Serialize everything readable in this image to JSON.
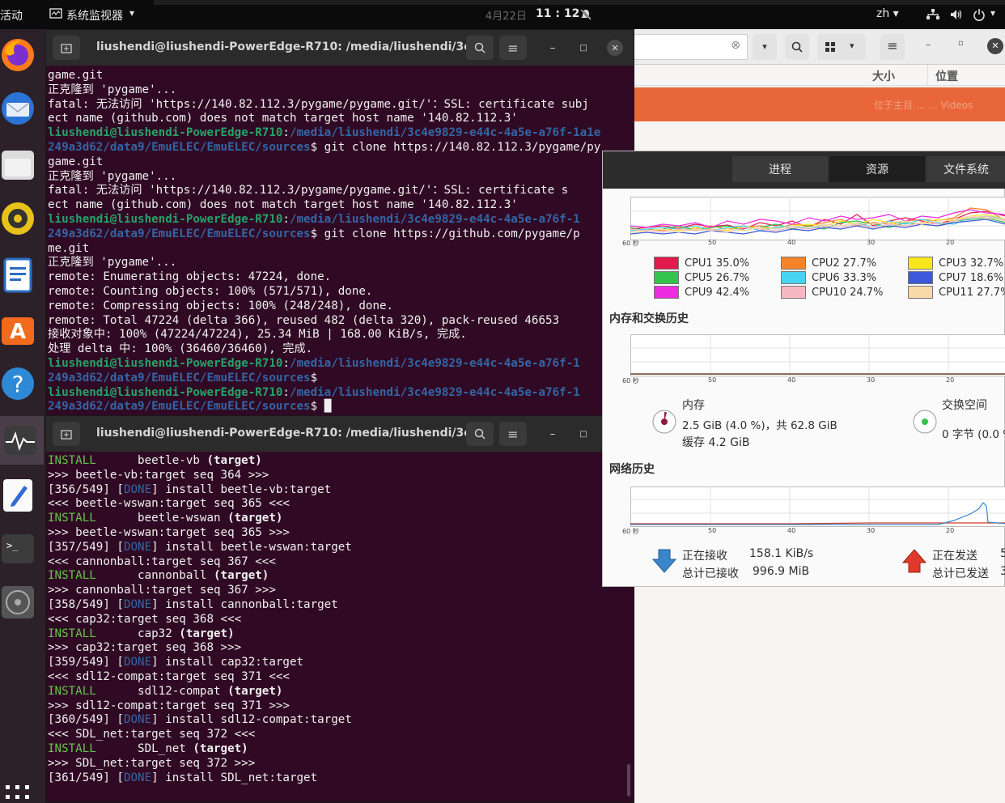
{
  "topbar": {
    "activities": "活动",
    "app_name": "系统监视器",
    "app_caret": "▾",
    "date_faint": "4月22日",
    "clock": "11 : 12",
    "lang": "zh ▾"
  },
  "dock": [
    "firefox-icon",
    "thunderbird-icon",
    "files-icon",
    "rhythmbox-icon",
    "writer-icon",
    "software-icon",
    "help-icon",
    "system-monitor-icon",
    "text-editor-icon",
    "terminal-icon",
    "disc-icon",
    "apps-grid-icon"
  ],
  "term1": {
    "title": "liushendi@liushendi-PowerEdge-R710: /media/liushendi/3c4...",
    "lines": [
      [
        [
          "",
          "game.git"
        ]
      ],
      [
        [
          "",
          "正克隆到 'pygame'..."
        ]
      ],
      [
        [
          "",
          "fatal: 无法访问 'https://140.82.112.3/pygame/pygame.git/'：SSL: certificate subj"
        ]
      ],
      [
        [
          "",
          "ect name (github.com) does not match target host name '140.82.112.3'"
        ]
      ],
      [
        [
          "pu",
          "liushendi@liushendi-PowerEdge-R710"
        ],
        [
          "",
          ":"
        ],
        [
          "pp",
          "/media/liushendi/3c4e9829-e44c-4a5e-a76f-1a1e"
        ]
      ],
      [
        [
          "pp",
          "249a3d62/data9/EmuELEC/EmuELEC/sources"
        ],
        [
          "",
          "$ git clone https://140.82.112.3/pygame/py"
        ]
      ],
      [
        [
          "",
          "game.git"
        ]
      ],
      [
        [
          "",
          "正克隆到 'pygame'..."
        ]
      ],
      [
        [
          "",
          "fatal: 无法访问 'https://140.82.112.3/pygame/pygame.git/'：SSL: certificate s"
        ]
      ],
      [
        [
          "",
          "ect name (github.com) does not match target host name '140.82.112.3'"
        ]
      ],
      [
        [
          "pu",
          "liushendi@liushendi-PowerEdge-R710"
        ],
        [
          "",
          ":"
        ],
        [
          "pp",
          "/media/liushendi/3c4e9829-e44c-4a5e-a76f-1"
        ]
      ],
      [
        [
          "pp",
          "249a3d62/data9/EmuELEC/EmuELEC/sources"
        ],
        [
          "",
          "$ git clone https://github.com/pygame/p"
        ]
      ],
      [
        [
          "",
          "me.git"
        ]
      ],
      [
        [
          "",
          "正克隆到 'pygame'..."
        ]
      ],
      [
        [
          "",
          "remote: Enumerating objects: 47224, done."
        ]
      ],
      [
        [
          "",
          "remote: Counting objects: 100% (571/571), done."
        ]
      ],
      [
        [
          "",
          "remote: Compressing objects: 100% (248/248), done."
        ]
      ],
      [
        [
          "",
          "remote: Total 47224 (delta 366), reused 482 (delta 320), pack-reused 46653"
        ]
      ],
      [
        [
          "",
          "接收对象中: 100% (47224/47224), 25.34 MiB | 168.00 KiB/s, 完成."
        ]
      ],
      [
        [
          "",
          "处理 delta 中: 100% (36460/36460), 完成."
        ]
      ],
      [
        [
          "pu",
          "liushendi@liushendi-PowerEdge-R710"
        ],
        [
          "",
          ":"
        ],
        [
          "pp",
          "/media/liushendi/3c4e9829-e44c-4a5e-a76f-1"
        ]
      ],
      [
        [
          "pp",
          "249a3d62/data9/EmuELEC/EmuELEC/sources"
        ],
        [
          "",
          "$"
        ]
      ],
      [
        [
          "pu",
          "liushendi@liushendi-PowerEdge-R710"
        ],
        [
          "",
          ":"
        ],
        [
          "pp",
          "/media/liushendi/3c4e9829-e44c-4a5e-a76f-1"
        ]
      ],
      [
        [
          "pp",
          "249a3d62/data9/EmuELEC/EmuELEC/sources"
        ],
        [
          "",
          "$ "
        ],
        [
          "cur",
          "█"
        ]
      ]
    ]
  },
  "term2": {
    "title": "liushendi@liushendi-PowerEdge-R710: /media/liushendi/3c4...",
    "lines": [
      [
        [
          "inst",
          "INSTALL"
        ],
        [
          "",
          "      beetle-vb "
        ],
        [
          "b",
          "(target)"
        ]
      ],
      [
        [
          "",
          ">>> beetle-vb:target seq 364 >>>"
        ]
      ],
      [
        [
          "",
          "[356/549] ["
        ],
        [
          "done",
          "DONE"
        ],
        [
          "",
          "] install beetle-vb:target"
        ]
      ],
      [
        [
          "",
          "<<< beetle-wswan:target seq 365 <<<"
        ]
      ],
      [
        [
          "inst",
          "INSTALL"
        ],
        [
          "",
          "      beetle-wswan "
        ],
        [
          "b",
          "(target)"
        ]
      ],
      [
        [
          "",
          ">>> beetle-wswan:target seq 365 >>>"
        ]
      ],
      [
        [
          "",
          "[357/549] ["
        ],
        [
          "done",
          "DONE"
        ],
        [
          "",
          "] install beetle-wswan:target"
        ]
      ],
      [
        [
          "",
          "<<< cannonball:target seq 367 <<<"
        ]
      ],
      [
        [
          "inst",
          "INSTALL"
        ],
        [
          "",
          "      cannonball "
        ],
        [
          "b",
          "(target)"
        ]
      ],
      [
        [
          "",
          ">>> cannonball:target seq 367 >>>"
        ]
      ],
      [
        [
          "",
          "[358/549] ["
        ],
        [
          "done",
          "DONE"
        ],
        [
          "",
          "] install cannonball:target"
        ]
      ],
      [
        [
          "",
          "<<< cap32:target seq 368 <<<"
        ]
      ],
      [
        [
          "inst",
          "INSTALL"
        ],
        [
          "",
          "      cap32 "
        ],
        [
          "b",
          "(target)"
        ]
      ],
      [
        [
          "",
          ">>> cap32:target seq 368 >>>"
        ]
      ],
      [
        [
          "",
          "[359/549] ["
        ],
        [
          "done",
          "DONE"
        ],
        [
          "",
          "] install cap32:target"
        ]
      ],
      [
        [
          "",
          "<<< sdl12-compat:target seq 371 <<<"
        ]
      ],
      [
        [
          "inst",
          "INSTALL"
        ],
        [
          "",
          "      sdl12-compat "
        ],
        [
          "b",
          "(target)"
        ]
      ],
      [
        [
          "",
          ">>> sdl12-compat:target seq 371 >>>"
        ]
      ],
      [
        [
          "",
          "[360/549] ["
        ],
        [
          "done",
          "DONE"
        ],
        [
          "",
          "] install sdl12-compat:target"
        ]
      ],
      [
        [
          "",
          "<<< SDL_net:target seq 372 <<<"
        ]
      ],
      [
        [
          "inst",
          "INSTALL"
        ],
        [
          "",
          "      SDL_net "
        ],
        [
          "b",
          "(target)"
        ]
      ],
      [
        [
          "",
          ">>> SDL_net:target seq 372 >>>"
        ]
      ],
      [
        [
          "",
          "[361/549] ["
        ],
        [
          "done",
          "DONE"
        ],
        [
          "",
          "] install SDL_net:target"
        ]
      ]
    ]
  },
  "filemanager": {
    "col_size": "大小",
    "col_location": "位置",
    "faint_row": "位于主目 ...  ...  Videos"
  },
  "sysmon": {
    "tabs": [
      "进程",
      "资源",
      "文件系统"
    ],
    "axis_labels": [
      "60 秒",
      "50",
      "40",
      "30",
      "20"
    ],
    "cpu_legend": [
      {
        "label": "CPU1",
        "value": "35.0%",
        "color": "#e01b4c"
      },
      {
        "label": "CPU2",
        "value": "27.7%",
        "color": "#f5832a"
      },
      {
        "label": "CPU3",
        "value": "32.7%",
        "color": "#f8e71c"
      },
      {
        "label": "CPU5",
        "value": "26.7%",
        "color": "#33c24b"
      },
      {
        "label": "CPU6",
        "value": "33.3%",
        "color": "#49d3f2"
      },
      {
        "label": "CPU7",
        "value": "18.6%",
        "color": "#3d59d9"
      },
      {
        "label": "CPU9",
        "value": "42.4%",
        "color": "#ee2be0"
      },
      {
        "label": "CPU10",
        "value": "24.7%",
        "color": "#f6b8c0"
      },
      {
        "label": "CPU11",
        "value": "27.7%",
        "color": "#fad9a9"
      }
    ],
    "mem_title": "内存和交换历史",
    "mem_label": "内存",
    "mem_used": "2.5 GiB (4.0 %)，共 62.8 GiB",
    "mem_cache": "缓存 4.2 GiB",
    "swap_label": "交换空间",
    "swap_used": "0 字节 (0.0 %",
    "net_title": "网络历史",
    "recv_label": "正在接收",
    "recv_rate": "158.1 KiB/s",
    "recv_total_label": "总计已接收",
    "recv_total": "996.9 MiB",
    "send_label": "正在发送",
    "send_total_label": "总计已发送",
    "send_rate_trunc": "5",
    "send_total_trunc": "3"
  }
}
